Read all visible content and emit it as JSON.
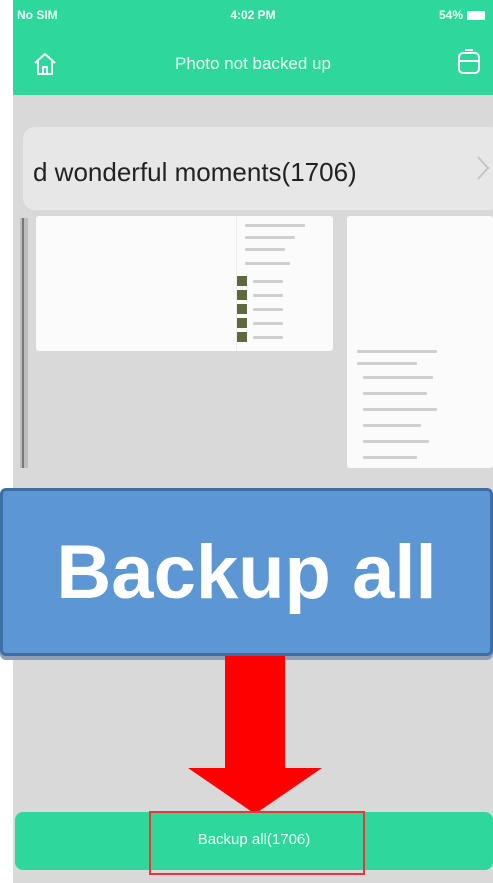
{
  "status_bar": {
    "carrier": "No SIM",
    "time": "4:02 PM",
    "battery": "54%"
  },
  "header": {
    "title": "Photo not backed up",
    "left_icon": "home-icon",
    "right_icon": "storage-icon"
  },
  "album": {
    "title": "d wonderful moments(1706)",
    "chevron_icon": "chevron-right-icon"
  },
  "banner": {
    "text": "Backup all"
  },
  "bottom_button": {
    "label": "Backup all(1706)"
  },
  "colors": {
    "brand_green": "#2ed89c",
    "banner_blue": "#5c97d4",
    "arrow_red": "#ff0000",
    "highlight_red": "#e53935",
    "background": "#d9d9d9"
  }
}
